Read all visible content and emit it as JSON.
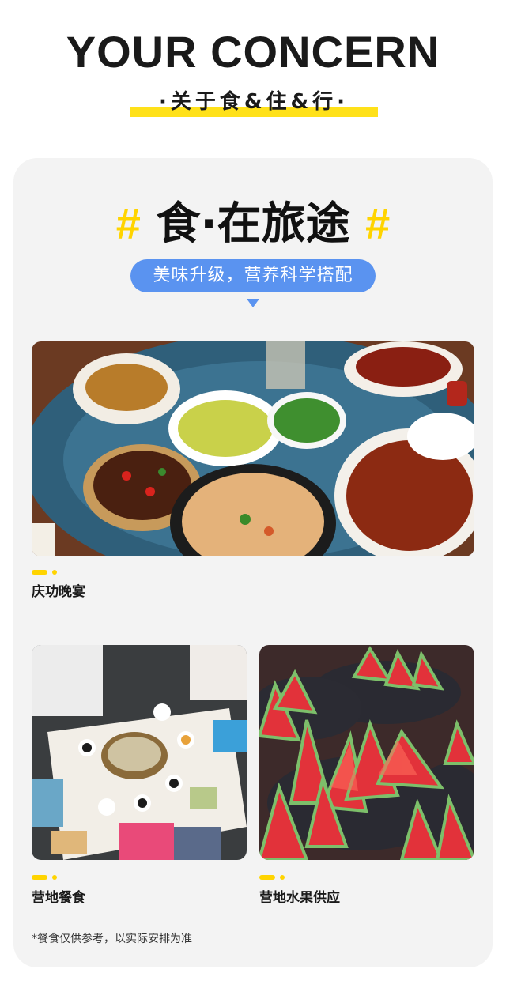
{
  "header": {
    "title": "YOUR CONCERN",
    "subtitle": "·关于食&住&行·"
  },
  "section": {
    "hash_left": "#",
    "title": "食·在旅途",
    "hash_right": "#",
    "pill_text": "美味升级，营养科学搭配"
  },
  "photos": [
    {
      "caption": "庆功晚宴",
      "icon": "banquet-table-photo"
    },
    {
      "caption": "营地餐食",
      "icon": "camp-meal-photo"
    },
    {
      "caption": "营地水果供应",
      "icon": "watermelon-photo"
    }
  ],
  "note": "*餐食仅供参考，以实际安排为准",
  "colors": {
    "accent_yellow": "#ffd400",
    "pill_blue": "#5a93f0",
    "card_bg": "#f3f3f3"
  }
}
